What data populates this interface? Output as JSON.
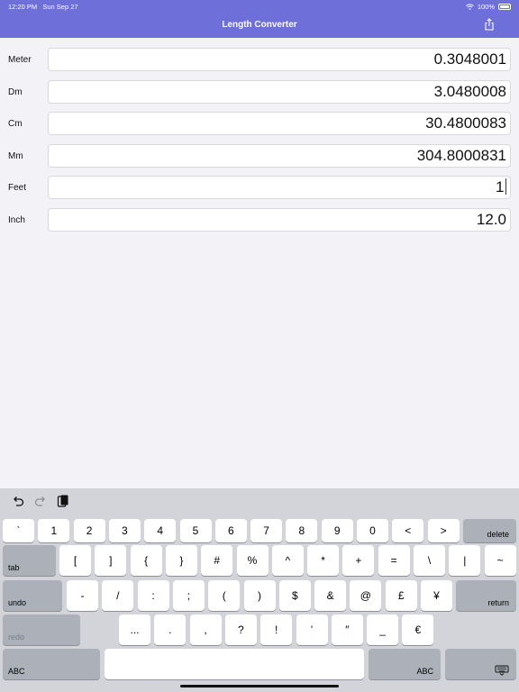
{
  "status_bar": {
    "time": "12:20 PM",
    "date": "Sun Sep 27",
    "battery": "100%"
  },
  "header": {
    "title": "Length Converter",
    "share_icon": "share-icon"
  },
  "fields": [
    {
      "label": "Meter",
      "value": "0.3048001"
    },
    {
      "label": "Dm",
      "value": "3.0480008"
    },
    {
      "label": "Cm",
      "value": "30.4800083"
    },
    {
      "label": "Mm",
      "value": "304.8000831"
    },
    {
      "label": "Feet",
      "value": "1"
    },
    {
      "label": "Inch",
      "value": "12.0"
    }
  ],
  "keyboard": {
    "toolbar": [
      "undo-icon",
      "redo-icon",
      "paste-icon"
    ],
    "row1": [
      "`",
      "1",
      "2",
      "3",
      "4",
      "5",
      "6",
      "7",
      "8",
      "9",
      "0",
      "<",
      ">"
    ],
    "delete": "delete",
    "tab": "tab",
    "row2": [
      "[",
      "]",
      "{",
      "}",
      "#",
      "%",
      "^",
      "*",
      "+",
      "=",
      "\\",
      "|",
      "~"
    ],
    "undo": "undo",
    "row3": [
      "-",
      "/",
      ":",
      ";",
      "(",
      ")",
      "$",
      "&",
      "@",
      "£",
      "¥"
    ],
    "return": "return",
    "redo": "redo",
    "row4": [
      "...",
      ".",
      ",",
      "?",
      "!",
      "’",
      "″",
      "_",
      "€"
    ],
    "abc": "ABC",
    "keyboard_icon": "keyboard-dismiss-icon"
  }
}
